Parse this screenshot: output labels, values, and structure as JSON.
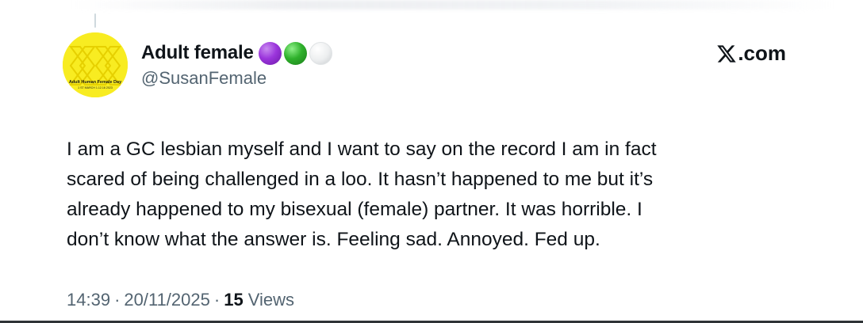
{
  "author": {
    "display_name": "Adult female",
    "handle": "@SusanFemale",
    "avatar": {
      "color": "#f8ec21",
      "text_line1": "Adult Human Female Day",
      "text_line2": "1 ST MARCH 1.12.16 2023"
    },
    "badges": [
      {
        "name": "purple-circle",
        "color": "#9b35dc"
      },
      {
        "name": "green-circle",
        "color": "#2fb12c"
      },
      {
        "name": "white-circle",
        "color": "#eceeef"
      }
    ]
  },
  "brand": {
    "icon": "x-logo-icon",
    "label": ".com"
  },
  "tweet": {
    "lines": [
      "I am a GC lesbian myself and I want to say on the record I am in fact",
      "scared of being challenged in a loo. It hasn’t happened to me but it’s",
      "already happened to my bisexual (female) partner. It was horrible. I",
      "don’t know what the answer is. Feeling sad. Annoyed. Fed up."
    ]
  },
  "meta": {
    "time": "14:39",
    "date": "20/11/2025",
    "separator": "·",
    "views_count": "15",
    "views_label": "Views"
  },
  "colors": {
    "text_primary": "#0f1419",
    "text_secondary": "#536471",
    "background": "#ffffff"
  }
}
